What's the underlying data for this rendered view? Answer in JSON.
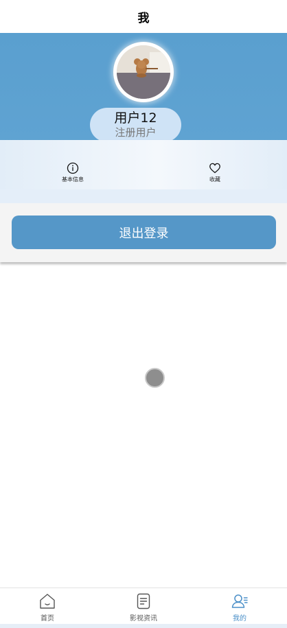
{
  "nav": {
    "title": "我"
  },
  "profile": {
    "name": "用户12",
    "role": "注册用户"
  },
  "quick_actions": [
    {
      "label": "基本信息",
      "icon": "info-icon"
    },
    {
      "label": "收藏",
      "icon": "heart-icon"
    }
  ],
  "logout": {
    "label": "退出登录"
  },
  "tabs": [
    {
      "label": "首页",
      "icon": "home-icon",
      "active": false
    },
    {
      "label": "影视资讯",
      "icon": "document-icon",
      "active": false
    },
    {
      "label": "我的",
      "icon": "user-icon",
      "active": true
    }
  ],
  "colors": {
    "header_blue": "#5fa3d2",
    "button_blue": "#5597c8",
    "active_tab": "#4a8fc8"
  }
}
